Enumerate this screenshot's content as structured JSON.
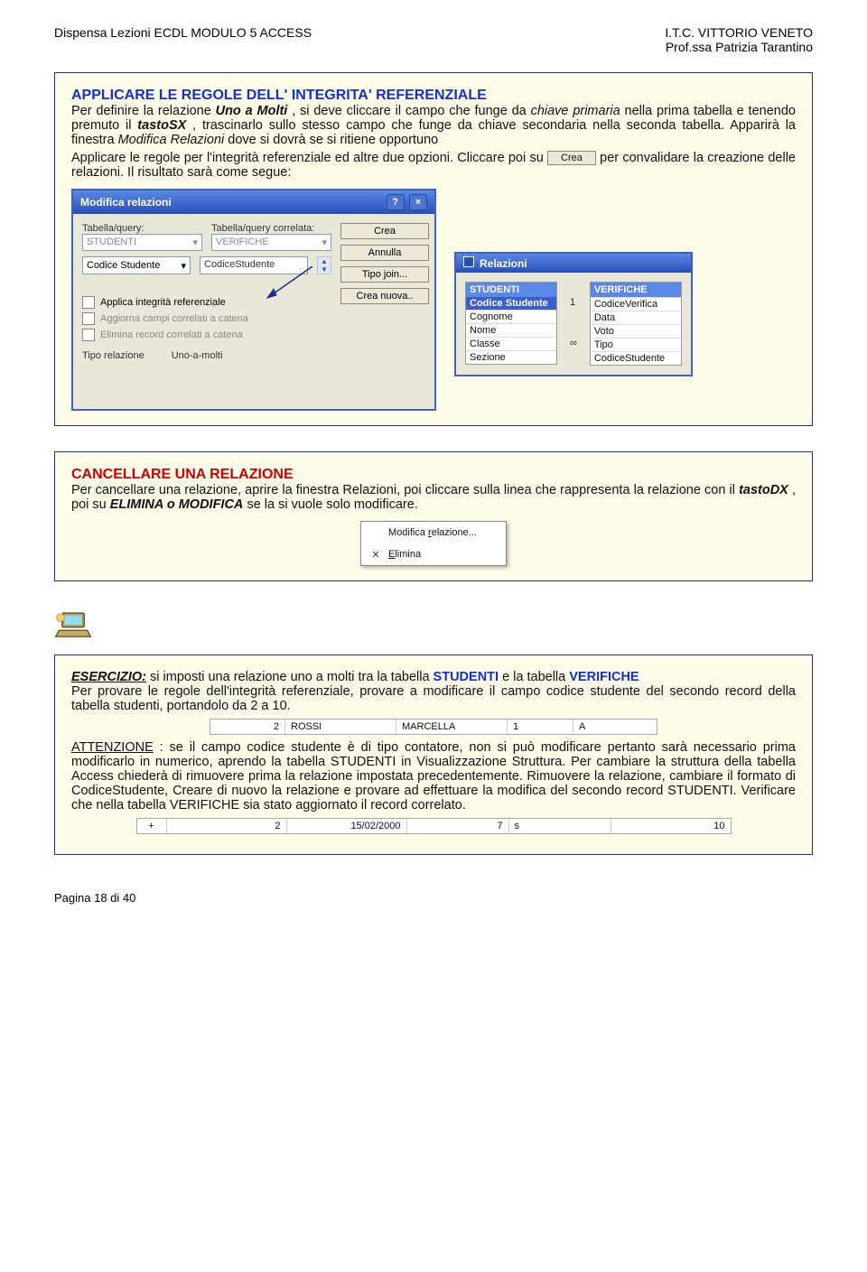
{
  "header": {
    "left": "Dispensa Lezioni ECDL  MODULO 5 ACCESS",
    "right1": "I.T.C. VITTORIO VENETO",
    "right2": "Prof.ssa Patrizia Tarantino"
  },
  "box1": {
    "title": "APPLICARE LE REGOLE DELL' INTEGRITA' REFERENZIALE",
    "p1a": "Per definire la relazione ",
    "p1b": "Uno a Molti",
    "p1c": ", si deve cliccare il campo che funge da ",
    "p1d": "chiave primaria",
    "p1e": " nella prima tabella e tenendo premuto il ",
    "p1f": "tastoSX",
    "p1g": ", trascinarlo sullo stesso campo che funge da chiave secondaria nella seconda tabella. Apparirà la finestra ",
    "p1h": "Modifica Relazioni",
    "p1i": " dove si dovrà se si ritiene opportuno",
    "p2a": "Applicare le regole per l'integrità referenziale ed altre due opzioni. Cliccare poi su ",
    "p2btn": "Crea",
    "p2b": " per convalidare la creazione delle relazioni. Il risultato sarà come segue:",
    "dialog": {
      "title": "Modifica relazioni",
      "lbl1": "Tabella/query:",
      "lbl2": "Tabella/query correlata:",
      "val1": "STUDENTI",
      "val2": "VERIFICHE",
      "combo1": "Codice Studente",
      "combo2": "CodiceStudente",
      "chk1": "Applica integrità referenziale",
      "chk2": "Aggiorna campi correlati a catena",
      "chk3": "Elimina record correlati a catena",
      "lbl3": "Tipo relazione",
      "val3": "Uno-a-molti",
      "btn_crea": "Crea",
      "btn_ann": "Annulla",
      "btn_tipo": "Tipo join...",
      "btn_nuova": "Crea nuova.."
    },
    "relwin": {
      "title": "Relazioni",
      "t1": "STUDENTI",
      "t1f0": "Codice Studente",
      "t1f1": "Cognome",
      "t1f2": "Nome",
      "t1f3": "Classe",
      "t1f4": "Sezione",
      "t2": "VERIFICHE",
      "t2f0": "CodiceVerifica",
      "t2f1": "Data",
      "t2f2": "Voto",
      "t2f3": "Tipo",
      "t2f4": "CodiceStudente",
      "one": "1",
      "inf": "∞"
    }
  },
  "box2": {
    "title": "CANCELLARE UNA RELAZIONE",
    "p1a": "Per cancellare una relazione, aprire la finestra Relazioni, poi cliccare sulla linea che rappresenta la relazione con il ",
    "p1b": "tastoDX",
    "p1c": ", poi su ",
    "p1d": "ELIMINA o MODIFICA",
    "p1e": " se la si vuole solo modificare.",
    "menu1": "Modifica relazione...",
    "menu2": "Elimina"
  },
  "box3": {
    "p1a": "ESERCIZIO:",
    "p1b": " si imposti una relazione uno a molti tra la tabella ",
    "p1c": "STUDENTI",
    "p1d": " e la tabella ",
    "p1e": "VERIFICHE",
    "p2": "Per provare le regole dell'integrità referenziale, provare a modificare il campo codice studente del secondo record della tabella studenti, portandolo da 2 a 10.",
    "row": {
      "c1": "2",
      "c2": "ROSSI",
      "c3": "MARCELLA",
      "c4": "1",
      "c5": "A"
    },
    "p3a": "ATTENZIONE",
    "p3b": ": se il campo codice studente è di tipo contatore, non si può modificare pertanto sarà necessario prima modificarlo in numerico, aprendo la tabella STUDENTI in Visualizzazione Struttura. Per cambiare la struttura della tabella Access chiederà di rimuovere prima la relazione impostata precedentemente. Rimuovere la relazione, cambiare il formato di CodiceStudente, Creare di nuovo la relazione e provare ad effettuare la modifica del secondo record STUDENTI. Verificare che nella tabella VERIFICHE sia stato aggiornato il record correlato.",
    "row2": {
      "c0": "+",
      "c1": "2",
      "c2": "15/02/2000",
      "c3": "7",
      "c4": "s",
      "c5": "10"
    }
  },
  "footer": "Pagina 18 di 40"
}
